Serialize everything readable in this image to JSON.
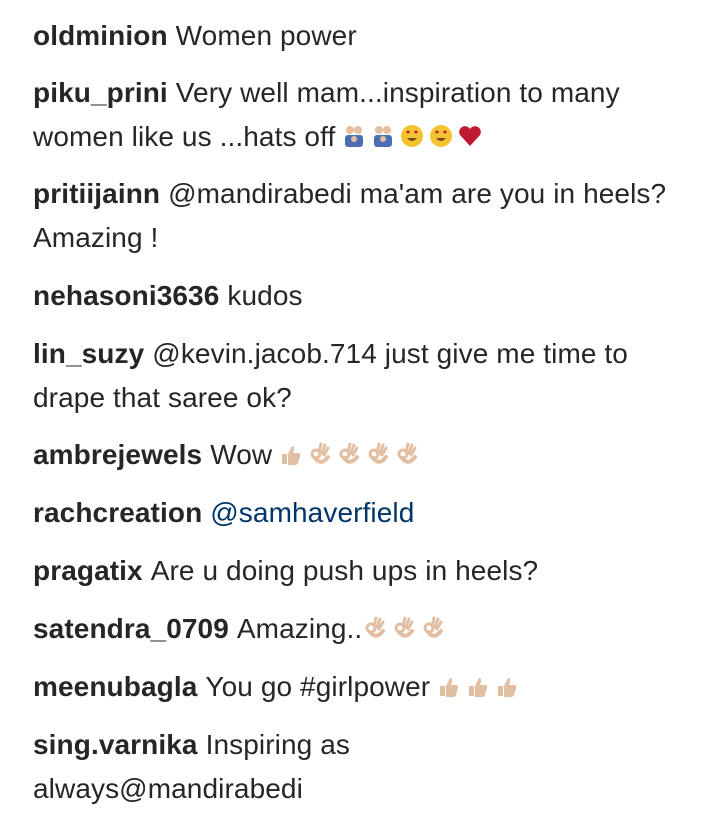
{
  "comments": [
    {
      "username": "oldminion",
      "text": "Women power"
    },
    {
      "username": "piku_prini",
      "text": "Very well mam...inspiration to many women like us ...hats off",
      "emojis": [
        "family-icon",
        "family-icon",
        "heart-eyes-icon",
        "heart-eyes-icon",
        "red-heart-icon"
      ]
    },
    {
      "username": "pritiijainn",
      "text": "@mandirabedi ma'am are you in heels? Amazing !"
    },
    {
      "username": "nehasoni3636",
      "text": "kudos"
    },
    {
      "username": "lin_suzy",
      "text": "@kevin.jacob.714 just give me time to drape that saree ok?"
    },
    {
      "username": "ambrejewels",
      "text": "Wow",
      "emojis": [
        "thumbs-up-icon",
        "ok-hand-icon",
        "ok-hand-icon",
        "ok-hand-icon",
        "ok-hand-icon"
      ]
    },
    {
      "username": "rachcreation",
      "text": "@samhaverfield"
    },
    {
      "username": "pragatix",
      "text": "Are u doing push ups in heels?"
    },
    {
      "username": "satendra_0709",
      "text": "Amazing..",
      "emojis": [
        "ok-hand-icon",
        "ok-hand-icon",
        "ok-hand-icon"
      ]
    },
    {
      "username": "meenubagla",
      "text": "You go #girlpower",
      "emojis": [
        "thumbs-up-icon",
        "thumbs-up-icon",
        "thumbs-up-icon"
      ]
    },
    {
      "username": "sing.varnika",
      "text": "Inspiring as always@mandirabedi"
    }
  ],
  "colors": {
    "text": "#262626",
    "skin_tone": "#e2bfa3",
    "heart": "#be1931",
    "smiley": "#f4c430"
  }
}
